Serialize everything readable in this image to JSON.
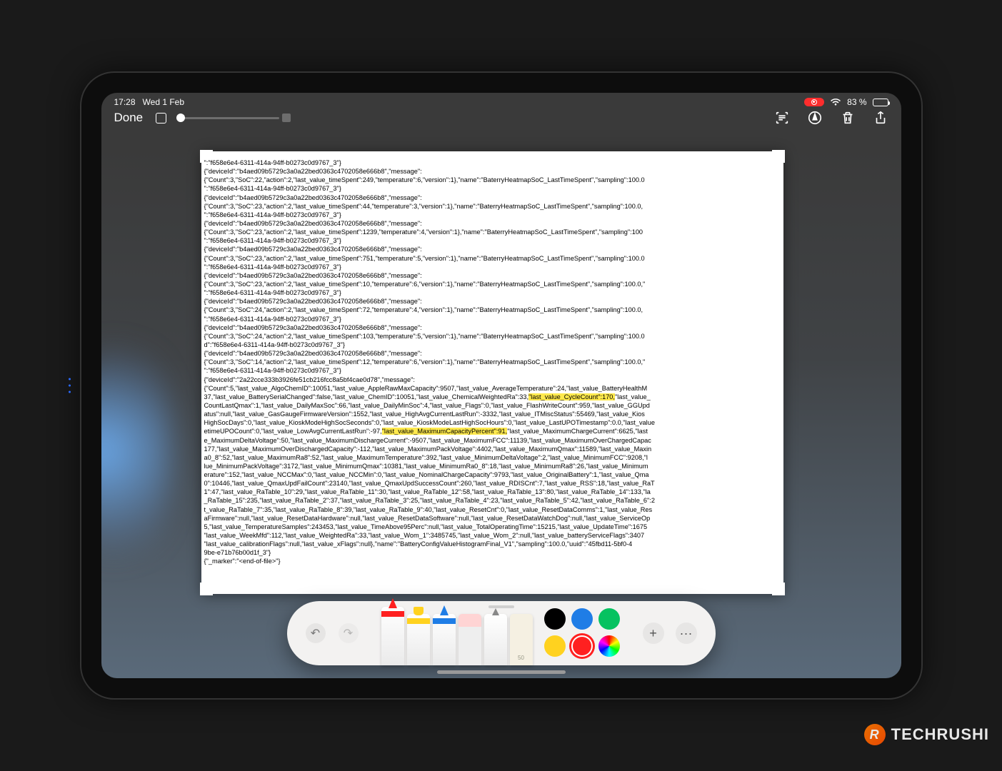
{
  "status": {
    "time": "17:28",
    "date": "Wed 1 Feb",
    "battery_text": "83 %",
    "wifi": "􀙇"
  },
  "toolbar": {
    "done": "Done"
  },
  "watermark": {
    "brand": "TECHRUSHI",
    "logo_letter": "R"
  },
  "doc": {
    "p01": "\":\"f658e6e4-6311-414a-94ff-b0273c0d9767_3\"}",
    "p02": "{\"deviceId\":\"b4aed09b5729c3a0a22bed0363c4702058e666b8\",\"message\":",
    "p03": "{\"Count\":3,\"SoC\":22,\"action\":2,\"last_value_timeSpent\":249,\"temperature\":6,\"version\":1},\"name\":\"BaterryHeatmapSoC_LastTimeSpent\",\"sampling\":100.0",
    "p04": "\":\"f658e6e4-6311-414a-94ff-b0273c0d9767_3\"}",
    "p05": "{\"deviceId\":\"b4aed09b5729c3a0a22bed0363c4702058e666b8\",\"message\":",
    "p06": "{\"Count\":3,\"SoC\":23,\"action\":2,\"last_value_timeSpent\":44,\"temperature\":3,\"version\":1},\"name\":\"BaterryHeatmapSoC_LastTimeSpent\",\"sampling\":100.0,",
    "p07": "\":\"f658e6e4-6311-414a-94ff-b0273c0d9767_3\"}",
    "p08": "{\"deviceId\":\"b4aed09b5729c3a0a22bed0363c4702058e666b8\",\"message\":",
    "p09": "{\"Count\":3,\"SoC\":23,\"action\":2,\"last_value_timeSpent\":1239,\"temperature\":4,\"version\":1},\"name\":\"BaterryHeatmapSoC_LastTimeSpent\",\"sampling\":100",
    "p10": "\":\"f658e6e4-6311-414a-94ff-b0273c0d9767_3\"}",
    "p11": "{\"deviceId\":\"b4aed09b5729c3a0a22bed0363c4702058e666b8\",\"message\":",
    "p12": "{\"Count\":3,\"SoC\":23,\"action\":2,\"last_value_timeSpent\":751,\"temperature\":5,\"version\":1},\"name\":\"BaterryHeatmapSoC_LastTimeSpent\",\"sampling\":100.0",
    "p13": "\":\"f658e6e4-6311-414a-94ff-b0273c0d9767_3\"}",
    "p14": "{\"deviceId\":\"b4aed09b5729c3a0a22bed0363c4702058e666b8\",\"message\":",
    "p15": "{\"Count\":3,\"SoC\":23,\"action\":2,\"last_value_timeSpent\":10,\"temperature\":6,\"version\":1},\"name\":\"BaterryHeatmapSoC_LastTimeSpent\",\"sampling\":100.0,\"",
    "p16": "\":\"f658e6e4-6311-414a-94ff-b0273c0d9767_3\"}",
    "p17": "{\"deviceId\":\"b4aed09b5729c3a0a22bed0363c4702058e666b8\",\"message\":",
    "p18": "{\"Count\":3,\"SoC\":24,\"action\":2,\"last_value_timeSpent\":72,\"temperature\":4,\"version\":1},\"name\":\"BaterryHeatmapSoC_LastTimeSpent\",\"sampling\":100.0,",
    "p19": "\":\"f658e6e4-6311-414a-94ff-b0273c0d9767_3\"}",
    "p20": "{\"deviceId\":\"b4aed09b5729c3a0a22bed0363c4702058e666b8\",\"message\":",
    "p21": "{\"Count\":3,\"SoC\":24,\"action\":2,\"last_value_timeSpent\":103,\"temperature\":5,\"version\":1},\"name\":\"BaterryHeatmapSoC_LastTimeSpent\",\"sampling\":100.0",
    "p22": "d\":\"f658e6e4-6311-414a-94ff-b0273c0d9767_3\"}",
    "p23": "{\"deviceId\":\"b4aed09b5729c3a0a22bed0363c4702058e666b8\",\"message\":",
    "p24": "{\"Count\":3,\"SoC\":14,\"action\":2,\"last_value_timeSpent\":12,\"temperature\":6,\"version\":1},\"name\":\"BaterryHeatmapSoC_LastTimeSpent\",\"sampling\":100.0,\"",
    "p25": "\":\"f658e6e4-6311-414a-94ff-b0273c0d9767_3\"}",
    "p26": "{\"deviceId\":\"2a22cce333b3926fe51cb216fcc8a5bf4cae0d78\",\"message\":",
    "p27a": "{\"Count\":5,\"last_value_AlgoChemID\":10051,\"last_value_AppleRawMaxCapacity\":9507,\"last_value_AverageTemperature\":24,\"last_value_BatteryHealthM",
    "p27b": "37,\"last_value_BatterySerialChanged\":false,\"last_value_ChemID\":10051,\"last_value_ChemicalWeightedRa\":33,",
    "hl1": "\"last_value_CycleCount\":170,",
    "p27c": "\"last_value_",
    "p28": "CountLastQmax\":1,\"last_value_DailyMaxSoc\":66,\"last_value_DailyMinSoc\":4,\"last_value_Flags\":0,\"last_value_FlashWriteCount\":959,\"last_value_GGUpd",
    "p29": "atus\":null,\"last_value_GasGaugeFirmwareVersion\":1552,\"last_value_HighAvgCurrentLastRun\":-3332,\"last_value_ITMiscStatus\":55469,\"last_value_Kios",
    "p30": "HighSocDays\":0,\"last_value_KioskModeHighSocSeconds\":0,\"last_value_KioskModeLastHighSocHours\":0,\"last_value_LastUPOTimestamp\":0.0,\"last_value",
    "p31a": "etimeUPOCount\":0,\"last_value_LowAvgCurrentLastRun\":-97,",
    "hl2": "\"last_value_MaximumCapacityPercent\":91,",
    "p31b": "\"last_value_MaximumChargeCurrent\":6625,\"last",
    "p32": "e_MaximumDeltaVoltage\":50,\"last_value_MaximumDischargeCurrent\":-9507,\"last_value_MaximumFCC\":11139,\"last_value_MaximumOverChargedCapac",
    "p33": "177,\"last_value_MaximumOverDischargedCapacity\":-112,\"last_value_MaximumPackVoltage\":4402,\"last_value_MaximumQmax\":11589,\"last_value_Maxin",
    "p34": "a0_8\":52,\"last_value_MaximumRa8\":52,\"last_value_MaximumTemperature\":392,\"last_value_MinimumDeltaVoltage\":2,\"last_value_MinimumFCC\":9208,\"l",
    "p35": "lue_MinimumPackVoltage\":3172,\"last_value_MinimumQmax\":10381,\"last_value_MinimumRa0_8\":18,\"last_value_MinimumRa8\":26,\"last_value_Minimum",
    "p36": "erature\":152,\"last_value_NCCMax\":0,\"last_value_NCCMin\":0,\"last_value_NominalChargeCapacity\":9793,\"last_value_OriginalBattery\":1,\"last_value_Qma",
    "p37": "0\":10446,\"last_value_QmaxUpdFailCount\":23140,\"last_value_QmaxUpdSuccessCount\":260,\"last_value_RDISCnt\":7,\"last_value_RSS\":18,\"last_value_RaT",
    "p38": "1\":47,\"last_value_RaTable_10\":29,\"last_value_RaTable_11\":30,\"last_value_RaTable_12\":58,\"last_value_RaTable_13\":80,\"last_value_RaTable_14\":133,\"la",
    "p39": "_RaTable_15\":235,\"last_value_RaTable_2\":37,\"last_value_RaTable_3\":25,\"last_value_RaTable_4\":23,\"last_value_RaTable_5\":42,\"last_value_RaTable_6\":2",
    "p40": "t_value_RaTable_7\":35,\"last_value_RaTable_8\":39,\"last_value_RaTable_9\":40,\"last_value_ResetCnt\":0,\"last_value_ResetDataComms\":1,\"last_value_Res",
    "p41": "aFirmware\":null,\"last_value_ResetDataHardware\":null,\"last_value_ResetDataSoftware\":null,\"last_value_ResetDataWatchDog\":null,\"last_value_ServiceOp",
    "p42": "5,\"last_value_TemperatureSamples\":243453,\"last_value_TimeAbove95Perc\":null,\"last_value_TotalOperatingTime\":15215,\"last_value_UpdateTime\":1675",
    "p43": "\"last_value_WeekMfd\":112,\"last_value_WeightedRa\":33,\"last_value_Wom_1\":3485745,\"last_value_Wom_2\":null,\"last_value_batteryServiceFlags\":3407",
    "p44": "\"last_value_calibrationFlags\":null,\"last_value_xFlags\":null},\"name\":\"BatteryConfigValueHistogramFinal_V1\",\"sampling\":100.0,\"uuid\":\"45fbd11-5bf0-4",
    "p45": "9be-e71b76b00d1f_3\"}",
    "p46": "{\"_marker\":\"<end-of-file>\"}"
  }
}
